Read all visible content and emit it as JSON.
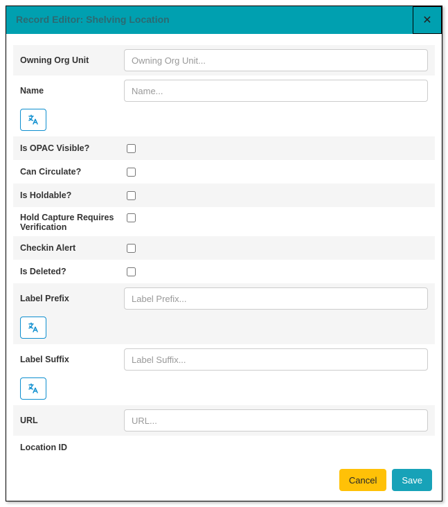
{
  "header": {
    "title": "Record Editor: Shelving Location"
  },
  "fields": {
    "owning_org": {
      "label": "Owning Org Unit",
      "placeholder": "Owning Org Unit..."
    },
    "name": {
      "label": "Name",
      "placeholder": "Name..."
    },
    "opac": {
      "label": "Is OPAC Visible?"
    },
    "circ": {
      "label": "Can Circulate?"
    },
    "holdable": {
      "label": "Is Holdable?"
    },
    "hold_verify": {
      "label": "Hold Capture Requires Verification"
    },
    "checkin": {
      "label": "Checkin Alert"
    },
    "deleted": {
      "label": "Is Deleted?"
    },
    "prefix": {
      "label": "Label Prefix",
      "placeholder": "Label Prefix..."
    },
    "suffix": {
      "label": "Label Suffix",
      "placeholder": "Label Suffix..."
    },
    "url": {
      "label": "URL",
      "placeholder": "URL..."
    },
    "loc_id": {
      "label": "Location ID"
    }
  },
  "buttons": {
    "cancel": "Cancel",
    "save": "Save"
  }
}
